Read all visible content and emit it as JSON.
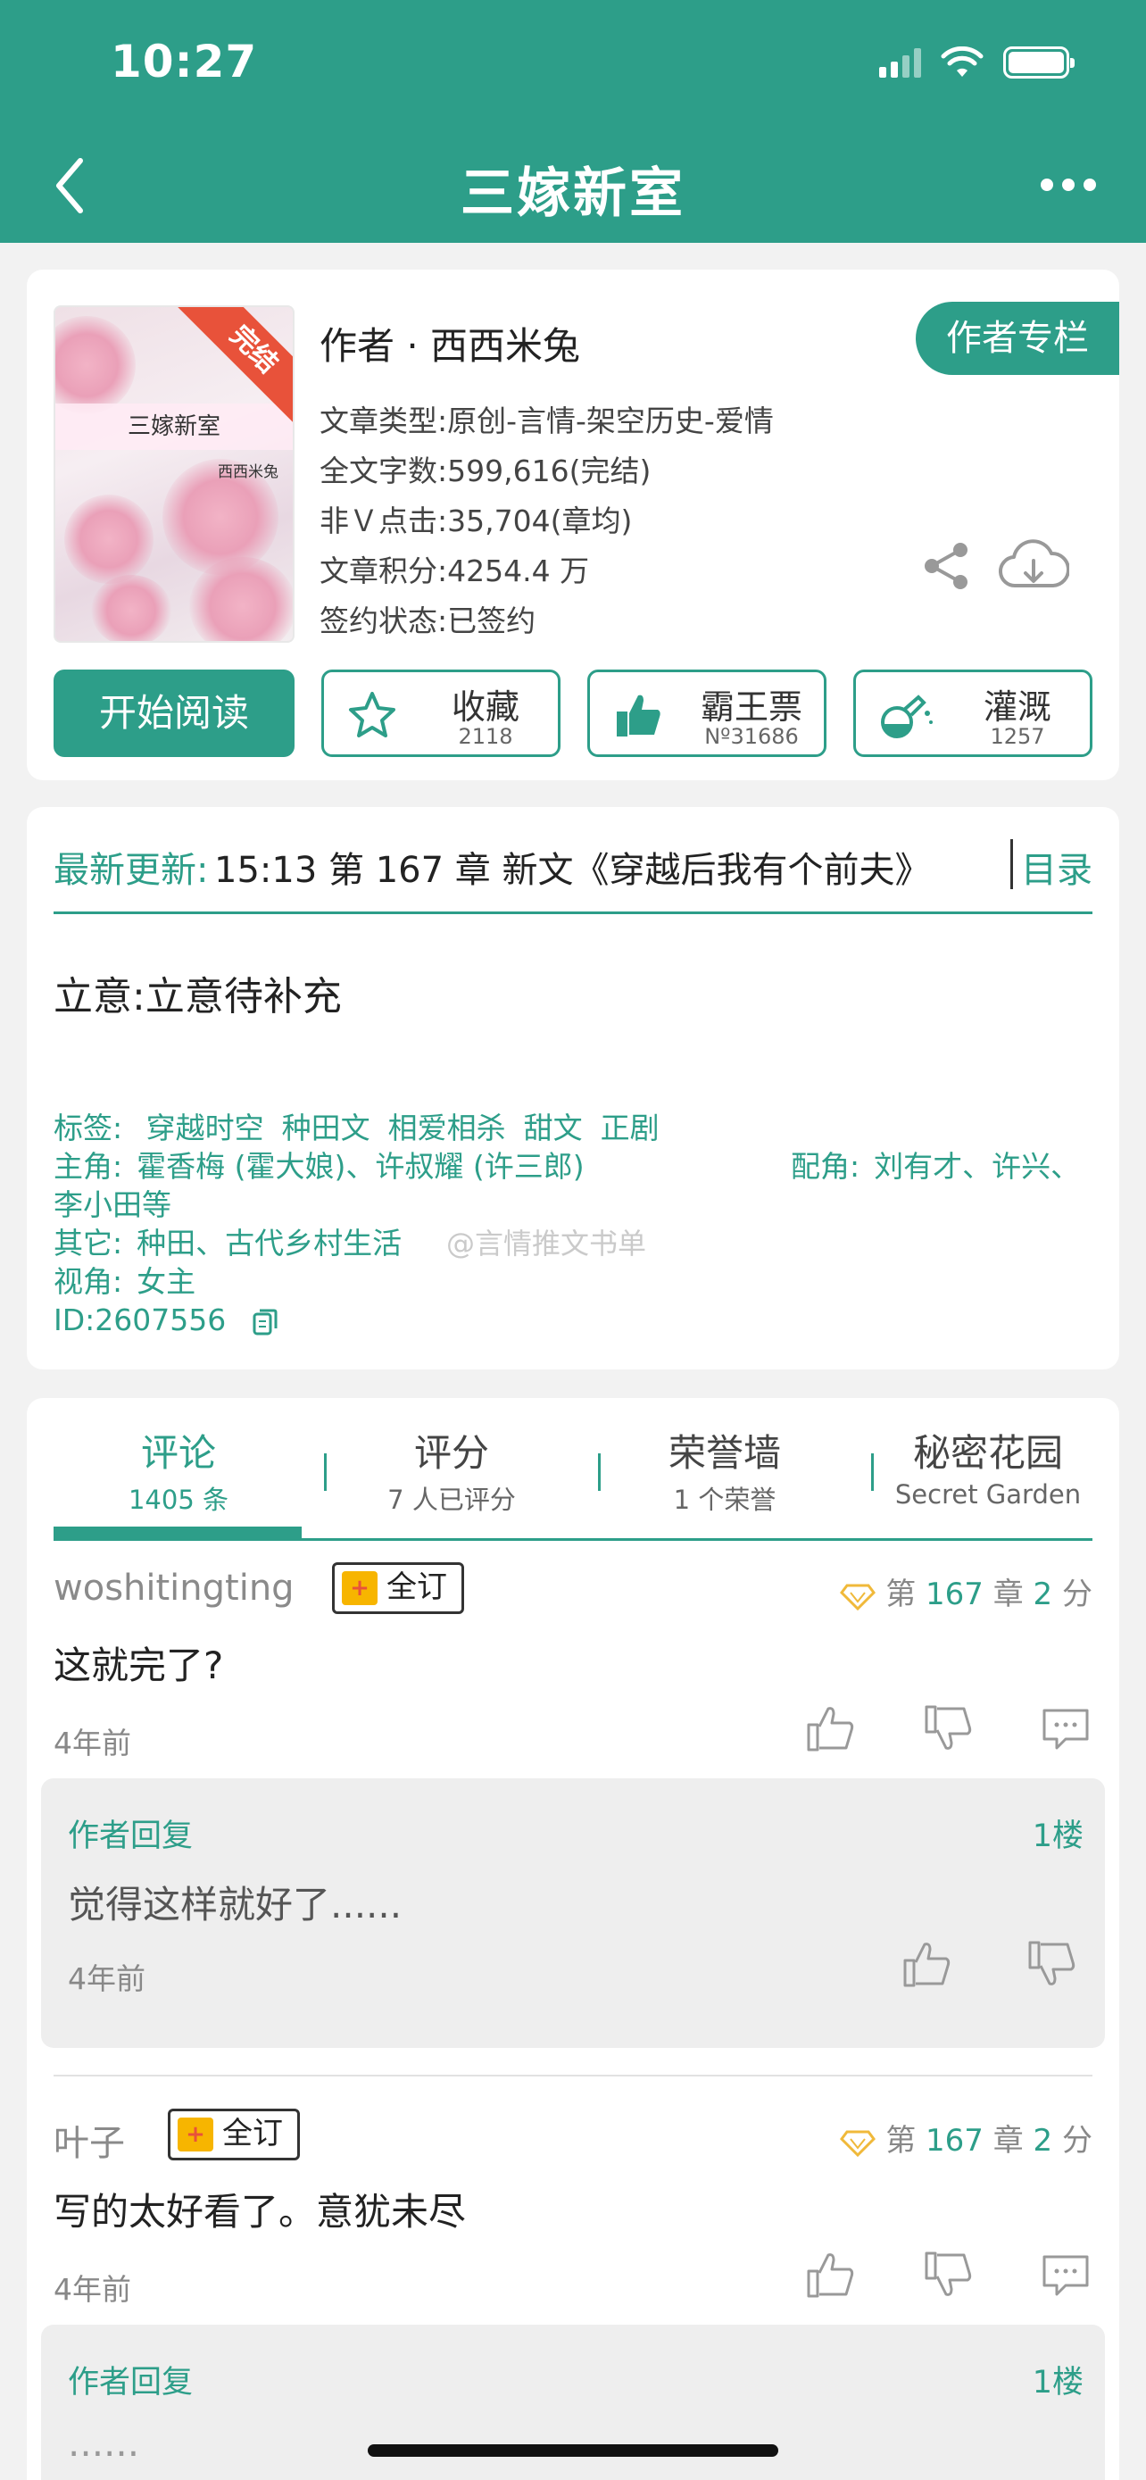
{
  "status": {
    "time": "10:27"
  },
  "nav": {
    "title": "三嫁新室"
  },
  "book": {
    "cover_title": "三嫁新室",
    "cover_author": "西西米兔",
    "ribbon": "完结",
    "author": "作者 · 西西米兔",
    "author_column": "作者专栏",
    "type": "文章类型:原创-言情-架空历史-爱情",
    "words": "全文字数:599,616(完结)",
    "clicks": "非Ｖ点击:35,704(章均)",
    "score": "文章积分:4254.4 万",
    "contract": "签约状态:已签约",
    "read_button": "开始阅读",
    "actions": [
      {
        "label": "收藏",
        "count": "2118"
      },
      {
        "label": "霸王票",
        "count": "Nº31686"
      },
      {
        "label": "灌溉",
        "count": "1257"
      }
    ]
  },
  "info": {
    "latest_label": "最新更新:",
    "latest_text": "15:13  第 167 章 新文《穿越后我有个前夫》",
    "catalog": "目录",
    "idea": "立意:立意待补充",
    "tags_label": "标签:",
    "tags": [
      "穿越时空",
      "种田文",
      "相爱相杀",
      "甜文",
      "正剧"
    ],
    "protagonist_label": "主角:",
    "protagonist": "霍香梅 (霍大娘)、许叔耀 (许三郎)",
    "supporting_label": "配角:",
    "supporting": "刘有才、许兴、",
    "supporting_cont": "李小田等",
    "other_label": "其它:",
    "other": "种田、古代乡村生活",
    "pov_label": "视角:",
    "pov": "女主",
    "id": "ID:2607556",
    "watermark": "@言情推文书单"
  },
  "tabs": [
    {
      "label": "评论",
      "sub": "1405 条",
      "active": true
    },
    {
      "label": "评分",
      "sub": "7 人已评分"
    },
    {
      "label": "荣誉墙",
      "sub": "1 个荣誉"
    },
    {
      "label": "秘密花园",
      "sub": "Secret Garden"
    }
  ],
  "comments": [
    {
      "user": "woshitingting",
      "badge": "全订",
      "chapter_pre": "第",
      "chapter_num": "167",
      "chapter_mid": "章",
      "score_num": "2",
      "score_unit": "分",
      "text": "这就完了?",
      "time": "4年前",
      "reply": {
        "label": "作者回复",
        "floor": "1楼",
        "text": "觉得这样就好了......",
        "time": "4年前"
      }
    },
    {
      "user": "叶子",
      "badge": "全订",
      "chapter_pre": "第",
      "chapter_num": "167",
      "chapter_mid": "章",
      "score_num": "2",
      "score_unit": "分",
      "text": "写的太好看了。意犹未尽",
      "time": "4年前",
      "reply": {
        "label": "作者回复",
        "floor": "1楼",
        "text": "......"
      }
    }
  ],
  "colors": {
    "accent": "#2d9e89",
    "ribbon": "#e8523a",
    "badge": "#f7b500"
  }
}
